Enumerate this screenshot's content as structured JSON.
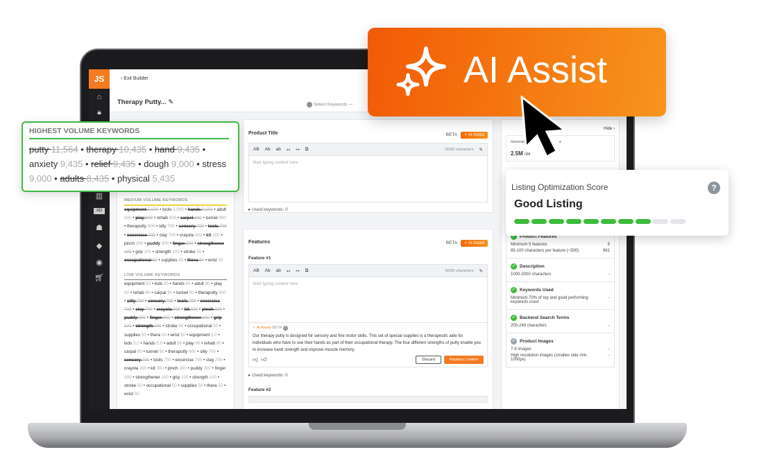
{
  "header": {
    "exit_label": "Exit Builder",
    "title": "Therapy Putty...",
    "step": "Select Keywords"
  },
  "sidebar": {
    "logo": "JS",
    "icons": [
      "home-icon",
      "lock-icon",
      "chart-icon",
      "ad-icon",
      "academy-icon",
      "graduation-icon",
      "chrome-icon",
      "cart-icon"
    ]
  },
  "highest": {
    "title": "HIGHEST VOLUME KEYWORDS",
    "items": [
      [
        "putty",
        "11,564",
        1
      ],
      [
        "therapy",
        "10,435",
        1
      ],
      [
        "hand",
        "9,435",
        1
      ],
      [
        "anxiety",
        "9,435",
        0
      ],
      [
        "relief",
        "9,435",
        1
      ],
      [
        "dough",
        "9,000",
        0
      ],
      [
        "stress",
        "9,000",
        0
      ],
      [
        "adults",
        "8,435",
        1
      ],
      [
        "physical",
        "5,435",
        0
      ]
    ]
  },
  "medium": {
    "title": "MEDIUM VOLUME KEYWORDS",
    "items": [
      [
        "equipment",
        "5,000",
        1
      ],
      [
        "tools",
        "5,000",
        0
      ],
      [
        "hands",
        "5,000",
        1
      ],
      [
        "adult",
        "900",
        0
      ],
      [
        "play",
        "900",
        1
      ],
      [
        "rehab",
        "900",
        0
      ],
      [
        "carpel",
        "900",
        1
      ],
      [
        "tunnel",
        "900",
        0
      ],
      [
        "theraputty",
        "900",
        0
      ],
      [
        "silly",
        "700",
        0
      ],
      [
        "sensory",
        "700",
        1
      ],
      [
        "tools",
        "700",
        1
      ],
      [
        "excercise",
        "700",
        1
      ],
      [
        "clay",
        "700",
        0
      ],
      [
        "crayola",
        "300",
        0
      ],
      [
        "kit",
        "300",
        2
      ],
      [
        "pinch",
        "300",
        0
      ],
      [
        "puddy",
        "300",
        2
      ],
      [
        "finger",
        "300",
        1
      ],
      [
        "strengthener",
        "100",
        1
      ],
      [
        "grip",
        "100",
        0
      ],
      [
        "strength",
        "100",
        0
      ],
      [
        "stroke",
        "50",
        0
      ],
      [
        "occupational",
        "50",
        1
      ],
      [
        "supplies",
        "50",
        0
      ],
      [
        "thera",
        "50",
        1
      ],
      [
        "wrist",
        "50",
        0
      ]
    ]
  },
  "low": {
    "title": "LOW VOLUME KEYWORDS",
    "items": [
      [
        "equipment",
        "50",
        0
      ],
      [
        "kids",
        "50",
        0
      ],
      [
        "hands",
        "50",
        0
      ],
      [
        "adult",
        "90",
        0
      ],
      [
        "play",
        "90",
        0
      ],
      [
        "rehab",
        "90",
        0
      ],
      [
        "carpal",
        "90",
        0
      ],
      [
        "tunnel",
        "90",
        0
      ],
      [
        "theraputty",
        "900",
        0
      ],
      [
        "silly",
        "700",
        1
      ],
      [
        "sensory",
        "700",
        1
      ],
      [
        "tools",
        "700",
        1
      ],
      [
        "excercise",
        "700",
        1
      ],
      [
        "clay",
        "700",
        1
      ],
      [
        "crayola",
        "300",
        1
      ],
      [
        "kit",
        "300",
        1
      ],
      [
        "pinch",
        "300",
        1
      ],
      [
        "puddy",
        "300",
        1
      ],
      [
        "finger",
        "300",
        1
      ],
      [
        "strengthener",
        "100",
        1
      ],
      [
        "grip",
        "100",
        1
      ],
      [
        "strength",
        "100",
        1
      ],
      [
        "stroke",
        "50",
        0
      ],
      [
        "occupational",
        "50",
        0
      ],
      [
        "supplies",
        "50",
        0
      ],
      [
        "thera",
        "50",
        0
      ],
      [
        "wrist",
        "50",
        0
      ],
      [
        "equipment",
        "5,0",
        0
      ],
      [
        "kids",
        "5,0",
        0
      ],
      [
        "hands",
        "5.0",
        0
      ],
      [
        "adult",
        "90",
        0
      ],
      [
        "play",
        "90",
        0
      ],
      [
        "rehab",
        "90",
        0
      ],
      [
        "carpal",
        "90",
        0
      ],
      [
        "tunnel",
        "90",
        0
      ],
      [
        "theraputty",
        "900",
        0
      ],
      [
        "silly",
        "700",
        0
      ],
      [
        "sensory",
        "700",
        1
      ],
      [
        "tools",
        "700",
        0
      ],
      [
        "excercise",
        "700",
        0
      ],
      [
        "clay",
        "700",
        0
      ],
      [
        "crayola",
        "300",
        0
      ],
      [
        "kit",
        "300",
        0
      ],
      [
        "pinch",
        "300",
        0
      ],
      [
        "puddy",
        "300",
        0
      ],
      [
        "finger",
        "300",
        0
      ],
      [
        "strengthener",
        "100",
        0
      ],
      [
        "grip",
        "100",
        0
      ],
      [
        "strength",
        "100",
        0
      ],
      [
        "stroke",
        "50",
        0
      ],
      [
        "occupational",
        "50",
        0
      ],
      [
        "supplies",
        "50",
        0
      ],
      [
        "thera",
        "50",
        0
      ],
      [
        "wrist",
        "50",
        0
      ]
    ]
  },
  "editor": {
    "beta": "BETA",
    "ai_assist": "AI Assist",
    "case_upper": "AB",
    "case_title": "Ab",
    "case_lower": "ab",
    "char_count": "0/200 characters",
    "placeholder": "Start typing content here",
    "used_keywords": "Used keywords: 0"
  },
  "product_title": {
    "label": "Product Title"
  },
  "features": {
    "label": "Features",
    "feature1": "Feature #1",
    "feature2": "Feature #2",
    "ai_label": "AI Assist",
    "ai_beta": "BETA",
    "suggestion": "Our therapy putty is designed for sensory and fine motor skills. This set of special supplies is a therapeutic aide for individuals who have to use their hands as part of their occupational therapy. The four different strengths of putty enable you to increase hand strength and improve muscle memory.",
    "discard": "Discard",
    "replace": "Replace Content"
  },
  "right": {
    "hide": "Hide",
    "generated_label": "Generated",
    "generated_suffix": "e",
    "generated_value": "2.5M",
    "generated_max": "/3M",
    "items": [
      {
        "title": "Product Features",
        "done": true,
        "rows": [
          [
            "Minimum 5 features",
            "5"
          ],
          [
            "85-100 characters per feature (~500)",
            "961"
          ]
        ]
      },
      {
        "title": "Description",
        "done": true,
        "rows": [
          [
            "1000-2000 characters",
            "-"
          ]
        ]
      },
      {
        "title": "Keywords Used",
        "done": true,
        "rows": [
          [
            "Minimum 70% of top and good performing keywords used",
            "-"
          ]
        ]
      },
      {
        "title": "Backend Search Terms",
        "done": true,
        "rows": [
          [
            "200-249 characters",
            "-"
          ]
        ]
      },
      {
        "title": "Product Images",
        "done": false,
        "rows": [
          [
            "7-9 images",
            "-"
          ],
          [
            "High resolution images (smalles side min. 1000px)",
            "-"
          ]
        ]
      }
    ]
  },
  "banner": {
    "label": "AI Assist"
  },
  "score": {
    "title": "Listing Optimization Score",
    "status": "Good Listing",
    "filled": 8,
    "total": 10
  },
  "colors": {
    "accent": "#f47b20",
    "success": "#3dbb3d",
    "banner_start": "#f25a05",
    "banner_end": "#f7941d"
  }
}
